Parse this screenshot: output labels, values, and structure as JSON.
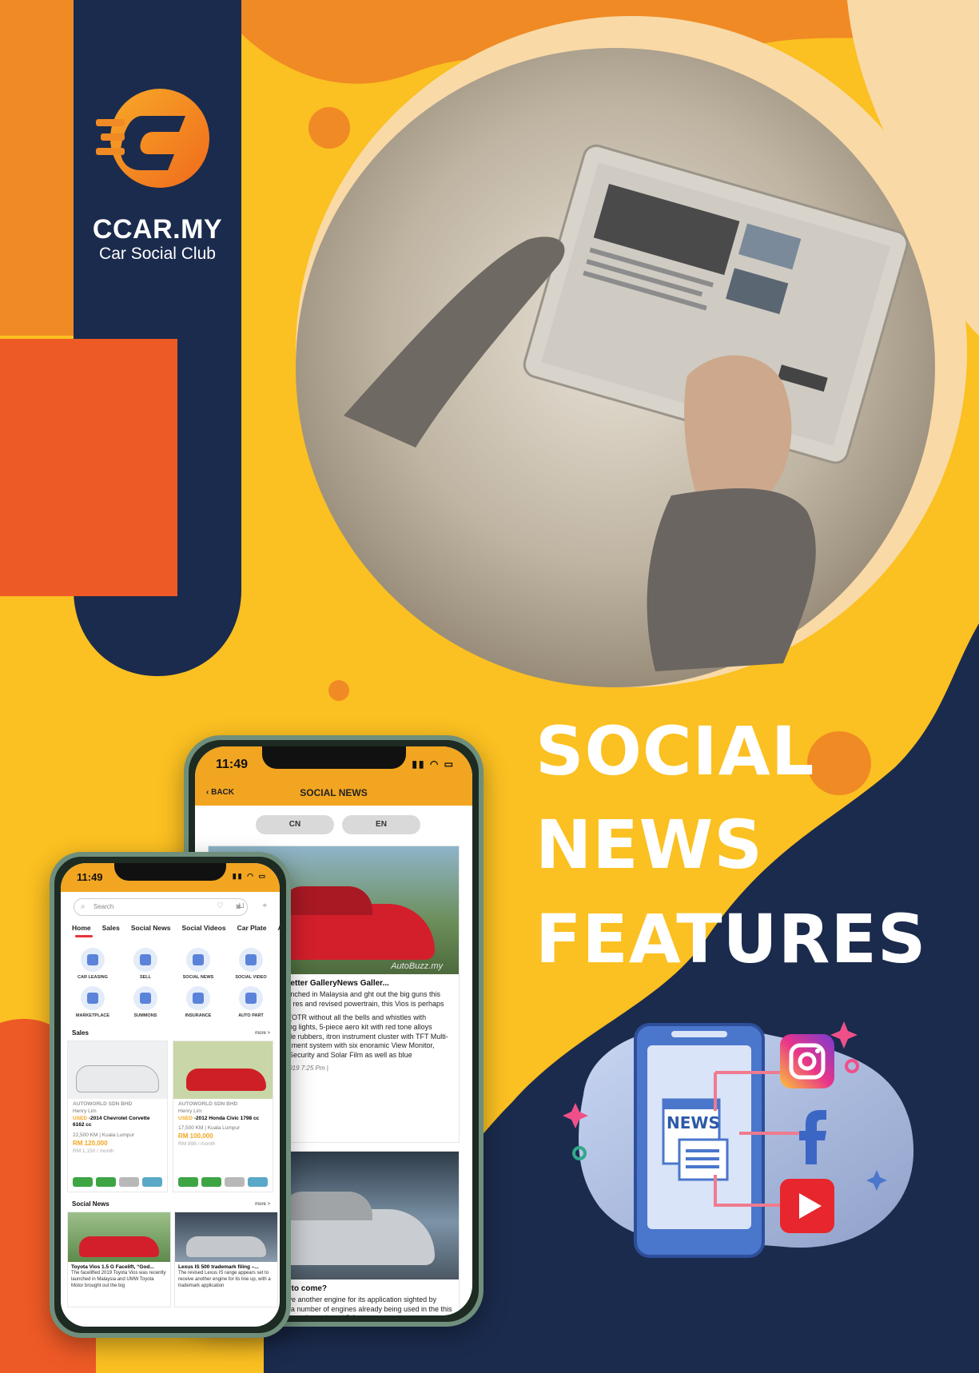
{
  "brand": {
    "name": "CCAR.MY",
    "tagline": "Car Social Club"
  },
  "headline": {
    "line1": "SOCIAL",
    "line2": "NEWS",
    "line3": "FEATURES"
  },
  "colors": {
    "yellow": "#fbc021",
    "orange": "#f08a24",
    "red_orange": "#ee5a26",
    "navy": "#1b2b4d",
    "peach": "#f9d9a6"
  },
  "news_phone": {
    "time": "11:49",
    "back_label": "BACK",
    "title": "SOCIAL NEWS",
    "lang_cn": "CN",
    "lang_en": "EN",
    "articles": [
      {
        "watermark": "AutoBuzz.my",
        "title": "lift, “God Car” got better GalleryNews Galler...",
        "body": "ta Vios was recently launched in Malaysia and ght out the big guns this time. Dressed in a fresh res and revised powertrain, this Vios is perhaps",
        "body2": "G, priced at RM87,300 (OTR without all the bells and whistles with halogen projector running lights, 5-piece aero kit with red tone alloys wrapped in 195/50 profile rubbers, itron instrument cluster with TFT Multi-Info ouchscreen infotainment system with six enoramic View Monitor, digital panel automatic Security and Solar Film as well as blue",
        "meta": "by Adrian Chia -May 24, 2019 7:25 Pm |"
      },
      {
        "title": "k filing – V6 biturbo to come?",
        "body": "ge appears set to receive another engine for its application sighted by forum GR86.org. The o a number of engines already being used in the this currently includes the naturally aspirated 5.0"
      }
    ]
  },
  "home_phone": {
    "time": "11:49",
    "search_placeholder": "Search",
    "tabs": [
      "Home",
      "Sales",
      "Social News",
      "Social Videos",
      "Car Plate",
      "Au"
    ],
    "categories": [
      "CAR LEASING",
      "SELL",
      "SOCIAL NEWS",
      "SOCIAL VIDEO",
      "MARKETPLACE",
      "SUMMONS",
      "INSURANCE",
      "AUTO PART"
    ],
    "sales_title": "Sales",
    "more_label": "more >",
    "listings": [
      {
        "dealer": "AUTOWORLD SDN BHD",
        "person": "Henry Lim",
        "used": "USED",
        "model": "-2014 Chevrolet Corvette 6162 cc",
        "info": "22,500 KM | Kuala Lumpur",
        "price": "RM 120,000",
        "monthly": "RM 1,150 / month"
      },
      {
        "dealer": "AUTOWORLD SDN BHD",
        "person": "Henry Lim",
        "used": "USED",
        "model": "-2012 Honda Civic 1798 cc",
        "info": "17,500 KM | Kuala Lumpur",
        "price": "RM 100,000",
        "monthly": "RM 898 / month"
      }
    ],
    "social_news_title": "Social News",
    "news": [
      {
        "title": "Toyota Vios 1.5 G Facelift, “God...",
        "body": "The facelifted 2019 Toyota Vios was recently launched in Malaysia and UMW Toyota Motor brought out the big"
      },
      {
        "title": "Lexus IS 500 trademark filing –...",
        "body": "The revised Lexus IS range appears set to receive another engine for its line up, with a trademark application"
      }
    ]
  },
  "social_icons": {
    "news_label": "NEWS",
    "icons": [
      "instagram-icon",
      "facebook-icon",
      "youtube-icon"
    ]
  }
}
